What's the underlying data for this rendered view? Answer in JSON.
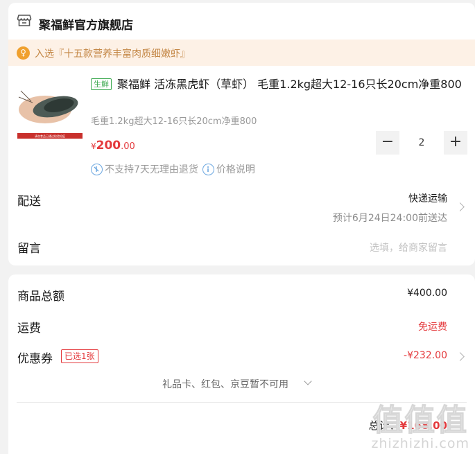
{
  "store": {
    "name": "聚福鲜官方旗舰店",
    "icon": "store-icon"
  },
  "banner": {
    "text": "入选『十五款营养丰富肉质细嫩虾』",
    "icon": "award-icon"
  },
  "product": {
    "tag": "生鲜",
    "title": "聚福鲜 活冻黑虎虾（草虾） 毛重1.2kg超大12-16只长20cm净重800",
    "spec": "毛重1.2kg超大12-16只长20cm净重800",
    "price_symbol": "¥",
    "price_int": "200",
    "price_dec": ".00",
    "quantity": "2",
    "minus_label": "−",
    "plus_label": "+",
    "no_return": "不支持7天无理由退货",
    "price_note": "价格说明",
    "image_caption": "请勿食品已通过检验检疫"
  },
  "delivery": {
    "label": "配送",
    "method": "快递运输",
    "eta": "预计6月24日24:00前送达"
  },
  "message": {
    "label": "留言",
    "placeholder": "选填，给商家留言"
  },
  "summary": {
    "total_label": "商品总额",
    "total_value": "¥400.00",
    "shipping_label": "运费",
    "shipping_value": "免运费",
    "coupon_label": "优惠券",
    "coupon_tag": "已选1张",
    "coupon_value": "-¥232.00",
    "unavailable": "礼品卡、红包、京豆暂不可用",
    "grand_label": "总计：",
    "grand_value": "¥168.00"
  },
  "watermark": {
    "big": "值值值",
    "small": "zhizhizhi.com"
  },
  "colors": {
    "accent_red": "#e4393c",
    "fresh_green": "#39a84d",
    "banner_bg": "#fdf1e6",
    "banner_text": "#c48746"
  }
}
